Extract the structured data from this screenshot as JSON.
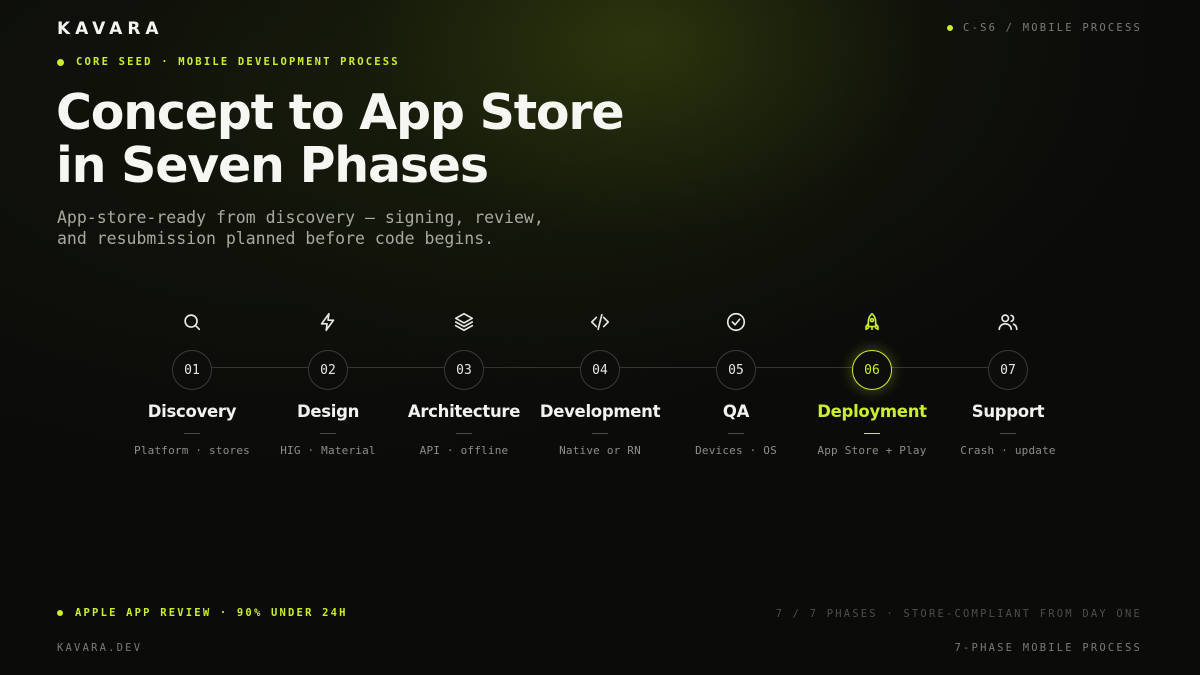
{
  "brand": "KAVARA",
  "top_right": "C-S6 / MOBILE PROCESS",
  "eyebrow": "CORE SEED · MOBILE DEVELOPMENT PROCESS",
  "title_line1": "Concept to App Store",
  "title_line2": "in Seven Phases",
  "subtitle_line1": "App-store-ready from discovery — signing, review,",
  "subtitle_line2": "and resubmission planned before code begins.",
  "accent_color": "#c9ef2e",
  "phases": [
    {
      "num": "01",
      "name": "Discovery",
      "desc": "Platform · stores",
      "icon": "search-icon"
    },
    {
      "num": "02",
      "name": "Design",
      "desc": "HIG · Material",
      "icon": "lightning-icon"
    },
    {
      "num": "03",
      "name": "Architecture",
      "desc": "API · offline",
      "icon": "layers-icon"
    },
    {
      "num": "04",
      "name": "Development",
      "desc": "Native or RN",
      "icon": "code-icon"
    },
    {
      "num": "05",
      "name": "QA",
      "desc": "Devices · OS",
      "icon": "check-circle-icon"
    },
    {
      "num": "06",
      "name": "Deployment",
      "desc": "App Store + Play",
      "icon": "rocket-icon",
      "active": true
    },
    {
      "num": "07",
      "name": "Support",
      "desc": "Crash · update",
      "icon": "users-icon"
    }
  ],
  "footer_left": "APPLE APP REVIEW · 90% UNDER 24H",
  "footer_right": "7 / 7 PHASES · STORE-COMPLIANT FROM DAY ONE",
  "site": "KAVARA.DEV",
  "process_label": "7-PHASE MOBILE PROCESS"
}
